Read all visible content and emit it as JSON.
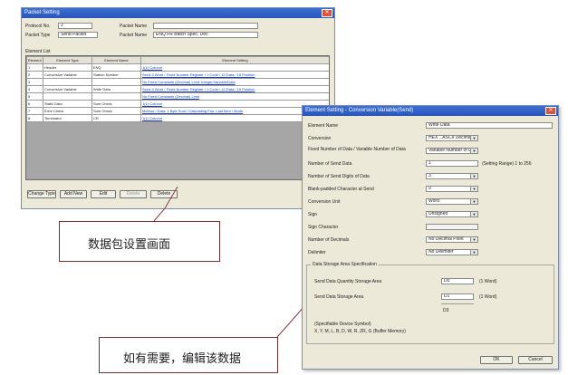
{
  "packet_window": {
    "title": "Packet Setting",
    "close_glyph": "✕",
    "fields": [
      {
        "label": "Protocol No.",
        "value": "2"
      },
      {
        "label": "Packet Type",
        "value": "Send Packet"
      },
      {
        "label": "Packet Name",
        "value": ""
      },
      {
        "label": "Packet Name",
        "value": "ENQ FR Batch Spec. Dec"
      }
    ],
    "list_label": "Element List",
    "table": {
      "headers": [
        "Element No.",
        "Element Type",
        "Element Name",
        "Element Setting"
      ],
      "rows": [
        {
          "no": "1",
          "type": "Header",
          "name": "ENQ",
          "setting": "1(1) Column"
        },
        {
          "no": "2",
          "type": "Conversion Variable",
          "name": "Station Number",
          "setting": "Send:3 Word / Fixed Number Register / 1 Code / 10 Data / 16 Position"
        },
        {
          "no": "3",
          "type": "",
          "name": "",
          "setting": "No Fixed Constants (Decimal) Limit: Integer/Variable/Data"
        },
        {
          "no": "4",
          "type": "Conversion Variable",
          "name": "Write Data",
          "setting": "Send:3 Word / Fixed Number Register / 1 Code / 10 Data / 16 Position"
        },
        {
          "no": "5",
          "type": "",
          "name": "",
          "setting": "No Fixed Constants (Decimal) Limit"
        },
        {
          "no": "6",
          "type": "Static Data",
          "name": "Sum Check",
          "setting": "1(1) Column"
        },
        {
          "no": "7",
          "type": "Error Check",
          "name": "Sum Check",
          "setting": "Method / Data: 1 Byte Sum / Calculating Pos: Last Item / Mode"
        },
        {
          "no": "8",
          "type": "Terminator",
          "name": "CR",
          "setting": "1(1) Column"
        }
      ]
    },
    "buttons": [
      "Change Type",
      "Add New",
      "Edit",
      "Delete",
      "Delete"
    ]
  },
  "element_window": {
    "title": "Element Setting - Conversion Variable(Send)",
    "close_glyph": "✕",
    "rows": [
      {
        "label": "Element Name",
        "value": "Write Data"
      },
      {
        "label": "Conversion",
        "value": "HEX→ASCII Decimal"
      },
      {
        "label": "Fixed Number of Data / Variable Number of Data",
        "value": "Variable Number of Data"
      },
      {
        "label": "Number of Send Data",
        "value": "1"
      },
      {
        "label": "Number of Send Digits of Data",
        "value": "3"
      },
      {
        "label": "Blank-padded Character at Send",
        "value": "0"
      },
      {
        "label": "Conversion Unit",
        "value": "Word"
      },
      {
        "label": "Sign",
        "value": "Unsigned"
      },
      {
        "label": "Sign Character",
        "value": ""
      },
      {
        "label": "Number of Decimals",
        "value": "No Decimal Point"
      },
      {
        "label": "Delimiter",
        "value": "No Delimiter"
      }
    ],
    "setting_range": "(Setting Range) 1 to 256",
    "group_title": "Data Storage Area Specification",
    "storage": [
      {
        "label": "Send Data Quantity Storage Area",
        "value": "D0",
        "unit": "(1 Word)"
      },
      {
        "label": "Send Data Storage Area",
        "value": "D1",
        "unit": "(1 Word)"
      }
    ],
    "storage_extra": "D3",
    "device_symbol_label": "(Specifiable Device Symbol)",
    "device_symbols": "X, Y, M, L, B, D, W, R, ZR, G (Buffer Memory)",
    "ok_label": "OK",
    "cancel_label": "Cancel"
  },
  "callouts": {
    "packet_caption": "数据包设置画面",
    "edit_caption": "如有需要，编辑该数据"
  }
}
